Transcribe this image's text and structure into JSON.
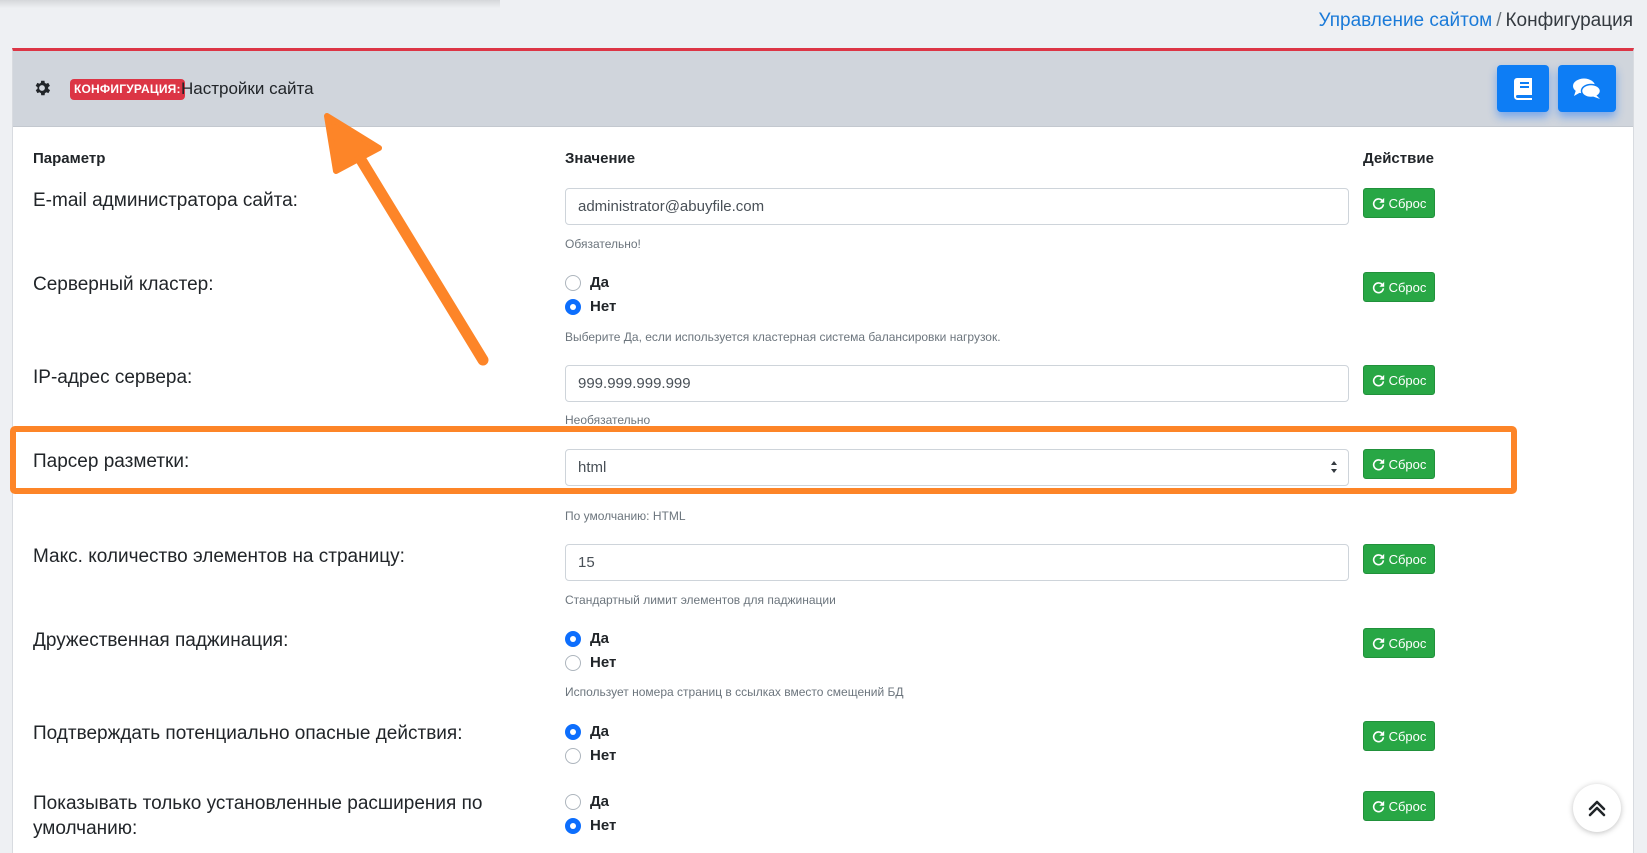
{
  "breadcrumb": {
    "parent": "Управление сайтом",
    "separator": "/",
    "current": "Конфигурация"
  },
  "header": {
    "badge": "КОНФИГУРАЦИЯ:",
    "title": "Настройки сайта",
    "icons": [
      "gear-icon",
      "book-icon",
      "comments-icon"
    ]
  },
  "columns": {
    "param": "Параметр",
    "value": "Значение",
    "action": "Действие"
  },
  "reset_label": "Сброс",
  "fields": {
    "admin_email": {
      "label": "E-mail администратора сайта:",
      "value": "administrator@abuyfile.com",
      "help": "Обязательно!"
    },
    "cluster": {
      "label": "Серверный кластер:",
      "yes": "Да",
      "no": "Нет",
      "selected": "Нет",
      "help": "Выберите Да, если используется кластерная система балансировки нагрузок."
    },
    "server_ip": {
      "label": "IP-адрес сервера:",
      "value": "999.999.999.999",
      "help": "Необязательно"
    },
    "markup_parser": {
      "label": "Парсер разметки:",
      "value": "html",
      "help": "По умолчанию: HTML"
    },
    "items_per_page": {
      "label": "Макс. количество элементов на страницу:",
      "value": "15",
      "help": "Стандартный лимит элементов для паджинации"
    },
    "friendly_pagination": {
      "label": "Дружественная паджинация:",
      "yes": "Да",
      "no": "Нет",
      "selected": "Да",
      "help": "Использует номера страниц в ссылках вместо смещений БД"
    },
    "confirm_dangerous": {
      "label": "Подтверждать потенциально опасные действия:",
      "yes": "Да",
      "no": "Нет",
      "selected": "Да"
    },
    "installed_extensions": {
      "label_line1": "Показывать только установленные расширения по",
      "label_line2": "умолчанию:",
      "yes": "Да",
      "no": "Нет",
      "selected": "Нет"
    }
  },
  "colors": {
    "accent": "#0d6efd",
    "badge": "#dc3545",
    "reset": "#28a745",
    "annotation": "#fd8528"
  }
}
